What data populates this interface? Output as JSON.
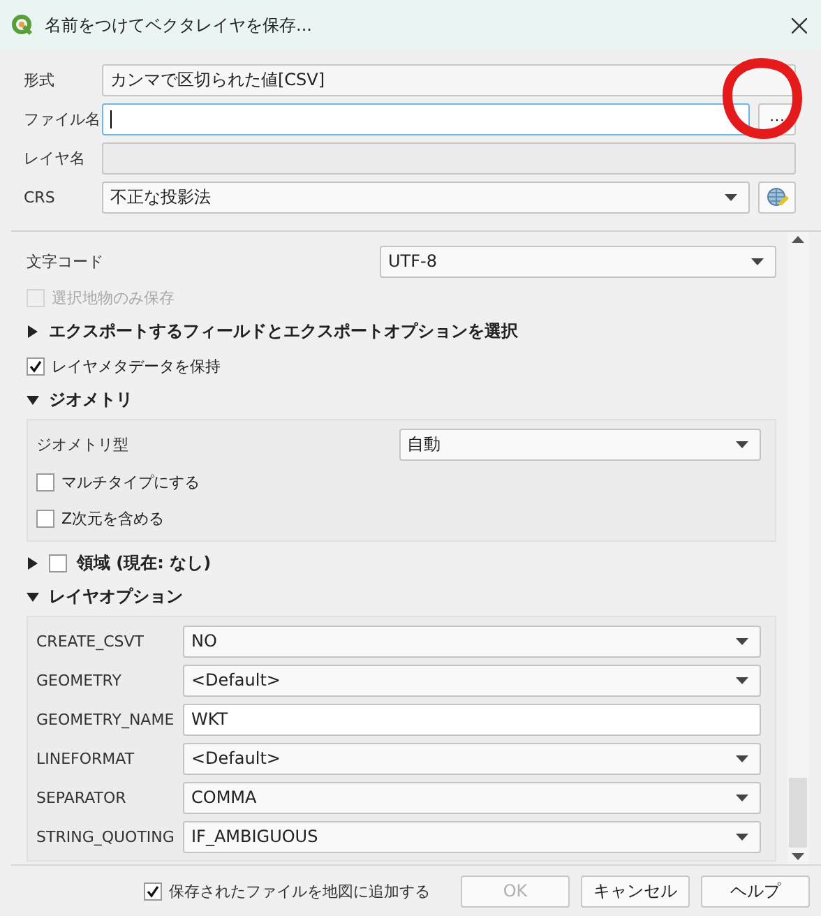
{
  "window": {
    "title": "名前をつけてベクタレイヤを保存..."
  },
  "form": [
    {
      "kind": "display",
      "label": "形式",
      "value": "カンマで区切られた値[CSV]"
    },
    {
      "kind": "file",
      "label": "ファイル名",
      "button": "···"
    },
    {
      "kind": "disabled",
      "label": "レイヤ名"
    },
    {
      "kind": "crs",
      "label": "CRS",
      "value": "不正な投影法"
    }
  ],
  "options": [
    {
      "kind": "combo",
      "label": "文字コード",
      "value": "UTF-8"
    },
    {
      "kind": "checkbox",
      "label": "選択地物のみ保存",
      "checked": false,
      "disabled": true
    },
    {
      "kind": "section",
      "label": "エクスポートするフィールドとエクスポートオプションを選択",
      "expanded": false
    },
    {
      "kind": "checkbox",
      "label": "レイヤメタデータを保持",
      "checked": true,
      "disabled": false
    },
    {
      "kind": "section",
      "label": "ジオメトリ",
      "expanded": true,
      "children": [
        {
          "kind": "combo",
          "label": "ジオメトリ型",
          "value": "自動"
        },
        {
          "kind": "checkbox",
          "label": "マルチタイプにする",
          "checked": false,
          "disabled": false
        },
        {
          "kind": "checkbox",
          "label": "Z次元を含める",
          "checked": false,
          "disabled": false
        }
      ]
    },
    {
      "kind": "section",
      "label": "領域 (現在: なし)",
      "expanded": false,
      "checked": false
    },
    {
      "kind": "section",
      "label": "レイヤオプション",
      "expanded": true,
      "children": [
        {
          "kind": "combo",
          "label": "CREATE_CSVT",
          "value": "NO"
        },
        {
          "kind": "combo",
          "label": "GEOMETRY",
          "value": "<Default>"
        },
        {
          "kind": "text",
          "label": "GEOMETRY_NAME",
          "value": "WKT"
        },
        {
          "kind": "combo",
          "label": "LINEFORMAT",
          "value": "<Default>"
        },
        {
          "kind": "combo",
          "label": "SEPARATOR",
          "value": "COMMA"
        },
        {
          "kind": "combo",
          "label": "STRING_QUOTING",
          "value": "IF_AMBIGUOUS"
        }
      ]
    }
  ],
  "footer": {
    "add_to_map": {
      "label": "保存されたファイルを地図に追加する",
      "checked": true
    },
    "buttons": [
      {
        "label": "OK",
        "disabled": true
      },
      {
        "label": "キャンセル",
        "disabled": false
      },
      {
        "label": "ヘルプ",
        "disabled": false
      }
    ]
  }
}
